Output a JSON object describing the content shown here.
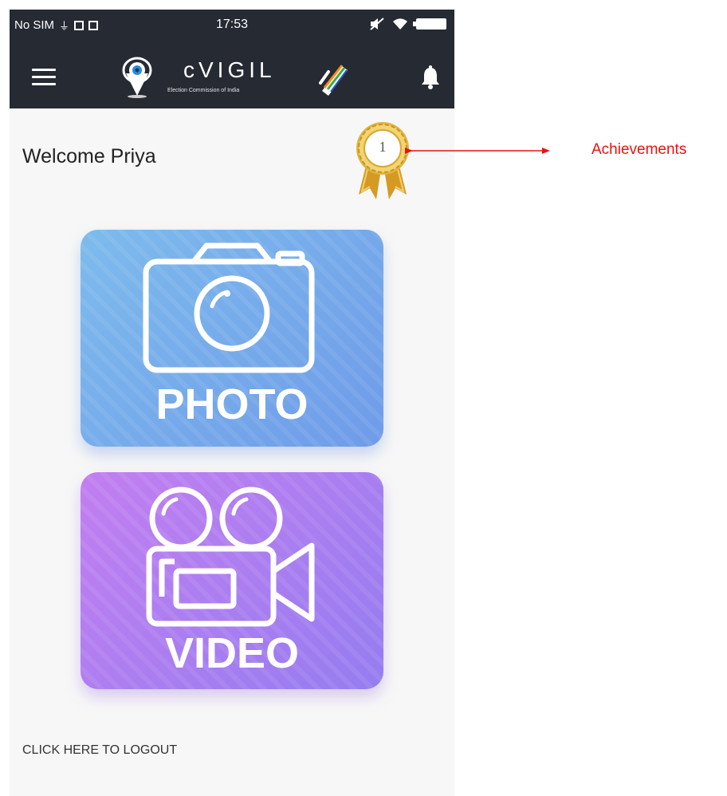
{
  "status_bar": {
    "carrier": "No SIM",
    "time": "17:53"
  },
  "header": {
    "app_title": "cVIGIL",
    "app_subtitle": "Election Commission of India",
    "menu_icon": "hamburger-icon",
    "notification_icon": "bell-icon",
    "logo_icon": "location-pin-eye-icon",
    "badge_icon": "ballot-finger-icon",
    "bar_color": "#252a33"
  },
  "welcome": {
    "text": "Welcome Priya"
  },
  "achievements": {
    "badge_count": "1",
    "icon": "medal-icon"
  },
  "actions": {
    "photo_label": "PHOTO",
    "photo_icon": "camera-icon",
    "photo_color": "#78aaec",
    "video_label": "VIDEO",
    "video_icon": "video-camera-icon",
    "video_color": "#b07ef0"
  },
  "footer": {
    "logout_label": "CLICK HERE TO LOGOUT"
  },
  "annotation": {
    "label": "Achievements",
    "color": "#ee1111"
  }
}
